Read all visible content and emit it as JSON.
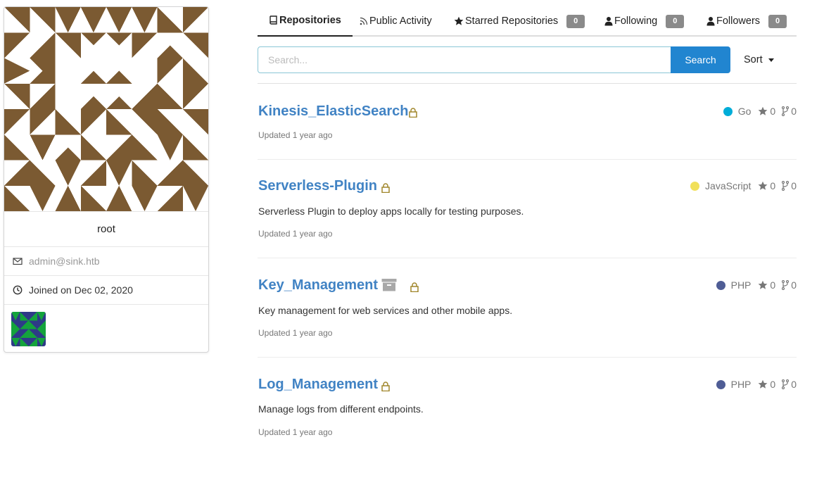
{
  "profile": {
    "username": "root",
    "email": "admin@sink.htb",
    "joined": "Joined on Dec 02, 2020",
    "avatar_color": "#7b5a32",
    "org_avatar_colors": [
      "#2e3a87",
      "#14a33c"
    ]
  },
  "tabs": [
    {
      "label": "Repositories",
      "icon": "book-icon",
      "active": true
    },
    {
      "label": "Public Activity",
      "icon": "rss-icon",
      "active": false
    },
    {
      "label": "Starred Repositories",
      "icon": "star-icon",
      "count": "0",
      "active": false
    },
    {
      "label": "Following",
      "icon": "person-icon",
      "count": "0",
      "active": false
    },
    {
      "label": "Followers",
      "icon": "person-icon",
      "count": "0",
      "active": false
    }
  ],
  "search": {
    "placeholder": "Search...",
    "value": "",
    "button_label": "Search",
    "sort_label": "Sort"
  },
  "repos": [
    {
      "name": "Kinesis_ElasticSearch",
      "private": true,
      "archived": false,
      "language": "Go",
      "language_color": "#00add8",
      "stars": "0",
      "forks": "0",
      "description": "",
      "updated": "Updated 1 year ago"
    },
    {
      "name": "Serverless-Plugin",
      "private": true,
      "archived": false,
      "language": "JavaScript",
      "language_color": "#f1e05a",
      "stars": "0",
      "forks": "0",
      "description": "Serverless Plugin to deploy apps locally for testing purposes.",
      "updated": "Updated 1 year ago"
    },
    {
      "name": "Key_Management",
      "private": true,
      "archived": true,
      "language": "PHP",
      "language_color": "#4f5d95",
      "stars": "0",
      "forks": "0",
      "description": "Key management for web services and other mobile apps.",
      "updated": "Updated 1 year ago"
    },
    {
      "name": "Log_Management",
      "private": true,
      "archived": false,
      "language": "PHP",
      "language_color": "#4f5d95",
      "stars": "0",
      "forks": "0",
      "description": "Manage logs from different endpoints.",
      "updated": "Updated 1 year ago"
    }
  ],
  "colors": {
    "accent": "#2185d0",
    "link": "#4183c4",
    "lock": "#a0862b",
    "badge": "#8a8a8a"
  }
}
